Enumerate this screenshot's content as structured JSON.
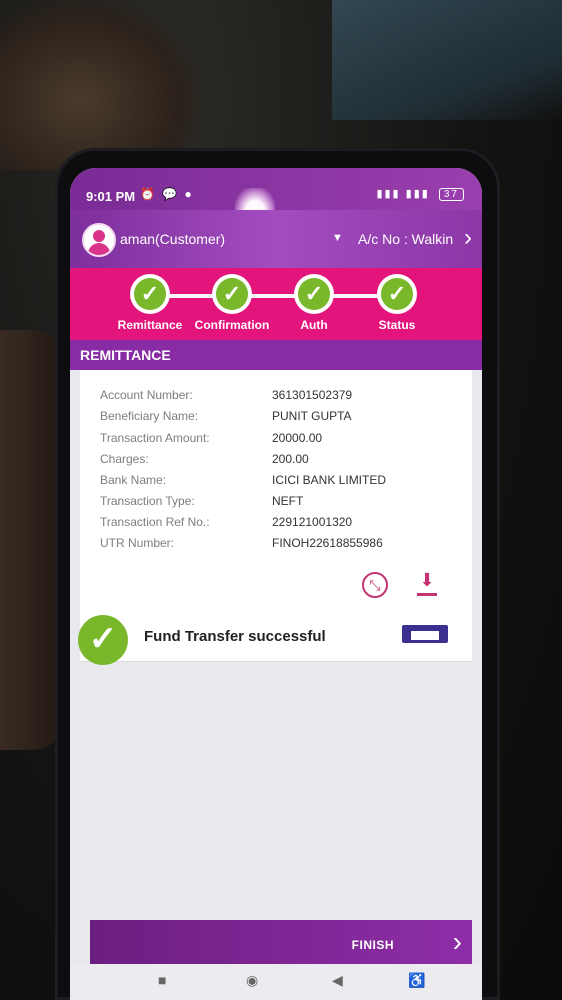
{
  "status_bar": {
    "time": "9:01 PM",
    "icons": [
      "alarm-icon",
      "messenger-icon",
      "chat-icon"
    ],
    "right_icons": [
      "sim-icon",
      "signal-icon",
      "lte-icon",
      "signal-icon"
    ],
    "battery": "37"
  },
  "header": {
    "user": "aman(Customer)",
    "account": "A/c No : Walkin"
  },
  "steps": [
    {
      "label": "Remittance",
      "icon": "check-icon"
    },
    {
      "label": "Confirmation",
      "icon": "check-icon"
    },
    {
      "label": "Auth",
      "icon": "check-icon"
    },
    {
      "label": "Status",
      "icon": "check-icon"
    }
  ],
  "section": {
    "title": "REMITTANCE"
  },
  "details": [
    {
      "key": "Account Number:",
      "value": "361301502379"
    },
    {
      "key": "Beneficiary Name:",
      "value": "PUNIT GUPTA"
    },
    {
      "key": "Transaction Amount:",
      "value": "20000.00"
    },
    {
      "key": "Charges:",
      "value": "200.00"
    },
    {
      "key": "Bank Name:",
      "value": "ICICI BANK LIMITED"
    },
    {
      "key": "Transaction Type:",
      "value": "NEFT"
    },
    {
      "key": "Transaction Ref No.:",
      "value": "229121001320"
    },
    {
      "key": "UTR Number:",
      "value": "FINOH22618855986"
    }
  ],
  "actions": {
    "share_icon": "share-icon",
    "download_icon": "download-icon"
  },
  "result": {
    "message": "Fund Transfer successful",
    "icon": "check-icon",
    "print_icon": "printer-icon"
  },
  "footer": {
    "finish_label": "FINISH"
  },
  "colors": {
    "purple": "#8a2ba6",
    "magenta": "#e3147c",
    "success_green": "#78b82a"
  }
}
